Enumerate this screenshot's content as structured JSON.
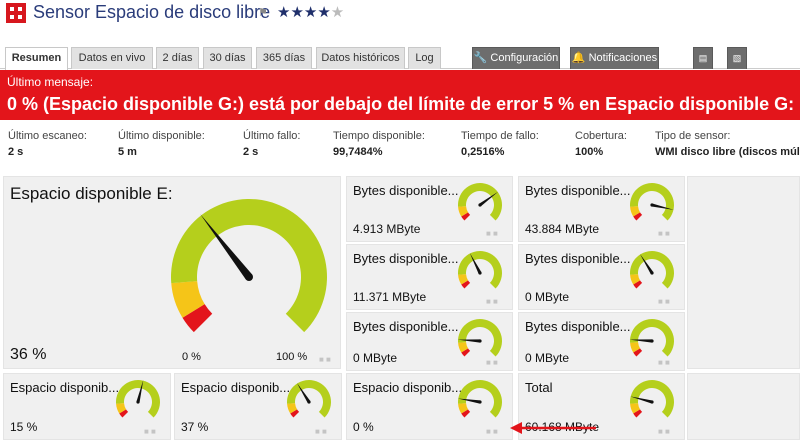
{
  "header": {
    "title": "Sensor Espacio de disco libre",
    "stars_filled": "★★★★",
    "stars_empty": "★",
    "flag_glyph": "⚑"
  },
  "tabs": [
    {
      "label": "Resumen"
    },
    {
      "label": "Datos en vivo"
    },
    {
      "label": "2 días"
    },
    {
      "label": "30 días"
    },
    {
      "label": "365 días"
    },
    {
      "label": "Datos históricos"
    },
    {
      "label": "Log"
    },
    {
      "label": "Configuración"
    },
    {
      "label": "Notificaciones"
    }
  ],
  "alert": {
    "label": "Último mensaje:",
    "message": "0 % (Espacio disponible G:) está por debajo del límite de error 5 % en Espacio disponible G:",
    "color": "#e3151b"
  },
  "stats": [
    {
      "key": "Último escaneo:",
      "value": "2 s"
    },
    {
      "key": "Último disponible:",
      "value": "5 m"
    },
    {
      "key": "Último fallo:",
      "value": "2 s"
    },
    {
      "key": "Tiempo disponible:",
      "value": "99,7484%"
    },
    {
      "key": "Tiempo de fallo:",
      "value": "0,2516%"
    },
    {
      "key": "Cobertura:",
      "value": "100%"
    },
    {
      "key": "Tipo de sensor:",
      "value": "WMI disco libre (discos múltiples)"
    }
  ],
  "main_gauge": {
    "name": "Espacio disponible E:",
    "value": "36 %",
    "min_label": "0 %",
    "max_label": "100 %",
    "level": 36
  },
  "gauges": [
    {
      "name": "Bytes disponible...",
      "value": "4.913 MByte",
      "level": 70
    },
    {
      "name": "Bytes disponible...",
      "value": "43.884 MByte",
      "level": 88
    },
    {
      "name": "Bytes disponible...",
      "value": "11.371 MByte",
      "level": 40
    },
    {
      "name": "Bytes disponible...",
      "value": "0 MByte",
      "level": 38
    },
    {
      "name": "Bytes disponible...",
      "value": "0 MByte",
      "level": 18
    },
    {
      "name": "Bytes disponible...",
      "value": "0 MByte",
      "level": 18
    },
    {
      "name": "Espacio disponib...",
      "value": "15 %",
      "level": 55
    },
    {
      "name": "Espacio disponib...",
      "value": "37 %",
      "level": 38
    },
    {
      "name": "Espacio disponib...",
      "value": "0 %",
      "level": 20
    },
    {
      "name": "Total",
      "value": "60.168 MByte",
      "level": 22
    }
  ],
  "colors": {
    "gauge_green": "#b5cf1c",
    "gauge_yellow": "#f5c518",
    "gauge_red": "#e3151b",
    "panel_bg": "#f0f0f0",
    "title_blue": "#2a3c7a"
  }
}
